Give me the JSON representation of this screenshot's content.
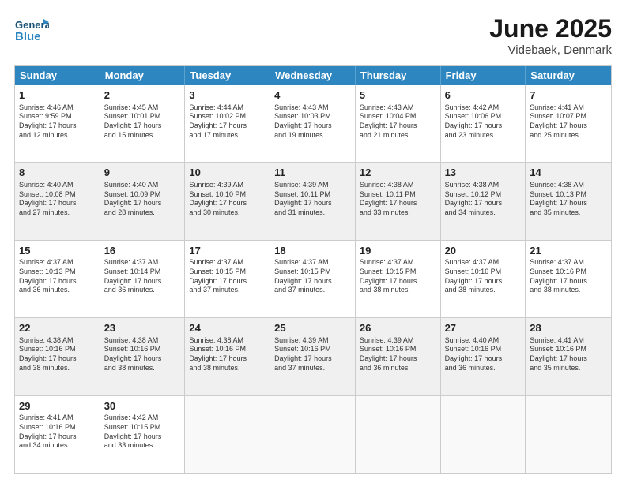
{
  "header": {
    "logo_line1": "General",
    "logo_line2": "Blue",
    "month": "June 2025",
    "location": "Videbaek, Denmark"
  },
  "weekdays": [
    "Sunday",
    "Monday",
    "Tuesday",
    "Wednesday",
    "Thursday",
    "Friday",
    "Saturday"
  ],
  "weeks": [
    [
      {
        "day": "1",
        "info": "Sunrise: 4:46 AM\nSunset: 9:59 PM\nDaylight: 17 hours\nand 12 minutes."
      },
      {
        "day": "2",
        "info": "Sunrise: 4:45 AM\nSunset: 10:01 PM\nDaylight: 17 hours\nand 15 minutes."
      },
      {
        "day": "3",
        "info": "Sunrise: 4:44 AM\nSunset: 10:02 PM\nDaylight: 17 hours\nand 17 minutes."
      },
      {
        "day": "4",
        "info": "Sunrise: 4:43 AM\nSunset: 10:03 PM\nDaylight: 17 hours\nand 19 minutes."
      },
      {
        "day": "5",
        "info": "Sunrise: 4:43 AM\nSunset: 10:04 PM\nDaylight: 17 hours\nand 21 minutes."
      },
      {
        "day": "6",
        "info": "Sunrise: 4:42 AM\nSunset: 10:06 PM\nDaylight: 17 hours\nand 23 minutes."
      },
      {
        "day": "7",
        "info": "Sunrise: 4:41 AM\nSunset: 10:07 PM\nDaylight: 17 hours\nand 25 minutes."
      }
    ],
    [
      {
        "day": "8",
        "info": "Sunrise: 4:40 AM\nSunset: 10:08 PM\nDaylight: 17 hours\nand 27 minutes."
      },
      {
        "day": "9",
        "info": "Sunrise: 4:40 AM\nSunset: 10:09 PM\nDaylight: 17 hours\nand 28 minutes."
      },
      {
        "day": "10",
        "info": "Sunrise: 4:39 AM\nSunset: 10:10 PM\nDaylight: 17 hours\nand 30 minutes."
      },
      {
        "day": "11",
        "info": "Sunrise: 4:39 AM\nSunset: 10:11 PM\nDaylight: 17 hours\nand 31 minutes."
      },
      {
        "day": "12",
        "info": "Sunrise: 4:38 AM\nSunset: 10:11 PM\nDaylight: 17 hours\nand 33 minutes."
      },
      {
        "day": "13",
        "info": "Sunrise: 4:38 AM\nSunset: 10:12 PM\nDaylight: 17 hours\nand 34 minutes."
      },
      {
        "day": "14",
        "info": "Sunrise: 4:38 AM\nSunset: 10:13 PM\nDaylight: 17 hours\nand 35 minutes."
      }
    ],
    [
      {
        "day": "15",
        "info": "Sunrise: 4:37 AM\nSunset: 10:13 PM\nDaylight: 17 hours\nand 36 minutes."
      },
      {
        "day": "16",
        "info": "Sunrise: 4:37 AM\nSunset: 10:14 PM\nDaylight: 17 hours\nand 36 minutes."
      },
      {
        "day": "17",
        "info": "Sunrise: 4:37 AM\nSunset: 10:15 PM\nDaylight: 17 hours\nand 37 minutes."
      },
      {
        "day": "18",
        "info": "Sunrise: 4:37 AM\nSunset: 10:15 PM\nDaylight: 17 hours\nand 37 minutes."
      },
      {
        "day": "19",
        "info": "Sunrise: 4:37 AM\nSunset: 10:15 PM\nDaylight: 17 hours\nand 38 minutes."
      },
      {
        "day": "20",
        "info": "Sunrise: 4:37 AM\nSunset: 10:16 PM\nDaylight: 17 hours\nand 38 minutes."
      },
      {
        "day": "21",
        "info": "Sunrise: 4:37 AM\nSunset: 10:16 PM\nDaylight: 17 hours\nand 38 minutes."
      }
    ],
    [
      {
        "day": "22",
        "info": "Sunrise: 4:38 AM\nSunset: 10:16 PM\nDaylight: 17 hours\nand 38 minutes."
      },
      {
        "day": "23",
        "info": "Sunrise: 4:38 AM\nSunset: 10:16 PM\nDaylight: 17 hours\nand 38 minutes."
      },
      {
        "day": "24",
        "info": "Sunrise: 4:38 AM\nSunset: 10:16 PM\nDaylight: 17 hours\nand 38 minutes."
      },
      {
        "day": "25",
        "info": "Sunrise: 4:39 AM\nSunset: 10:16 PM\nDaylight: 17 hours\nand 37 minutes."
      },
      {
        "day": "26",
        "info": "Sunrise: 4:39 AM\nSunset: 10:16 PM\nDaylight: 17 hours\nand 36 minutes."
      },
      {
        "day": "27",
        "info": "Sunrise: 4:40 AM\nSunset: 10:16 PM\nDaylight: 17 hours\nand 36 minutes."
      },
      {
        "day": "28",
        "info": "Sunrise: 4:41 AM\nSunset: 10:16 PM\nDaylight: 17 hours\nand 35 minutes."
      }
    ],
    [
      {
        "day": "29",
        "info": "Sunrise: 4:41 AM\nSunset: 10:16 PM\nDaylight: 17 hours\nand 34 minutes."
      },
      {
        "day": "30",
        "info": "Sunrise: 4:42 AM\nSunset: 10:15 PM\nDaylight: 17 hours\nand 33 minutes."
      },
      {
        "day": "",
        "info": ""
      },
      {
        "day": "",
        "info": ""
      },
      {
        "day": "",
        "info": ""
      },
      {
        "day": "",
        "info": ""
      },
      {
        "day": "",
        "info": ""
      }
    ]
  ]
}
